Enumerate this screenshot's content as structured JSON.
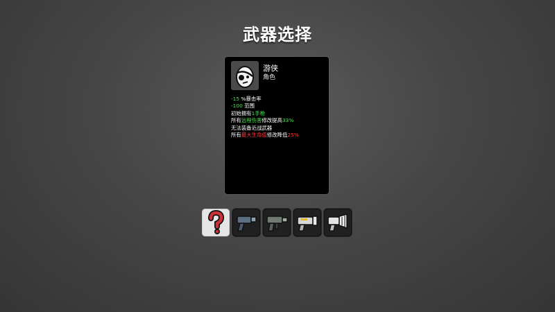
{
  "title": "武器选择",
  "character": {
    "name": "游侠",
    "type": "角色",
    "icon": "egg-eyepatch-icon"
  },
  "stats": [
    {
      "value": "-15",
      "value_color": "#47e64a",
      "text": " %暴击率"
    },
    {
      "value": "-100",
      "value_color": "#47e64a",
      "text": " 范围"
    },
    {
      "prefix": "初始拥有",
      "highlight": "1手枪",
      "highlight_color": "#47e64a"
    },
    {
      "prefix": "所有",
      "highlight": "远程伤害",
      "highlight_color": "#47e64a",
      "mid": "修改提高",
      "value": "33%",
      "value_color": "#47e64a"
    },
    {
      "prefix": "无法装备近战武器"
    },
    {
      "prefix": "所有",
      "highlight": "最大生命值",
      "highlight_color": "#ff3b3b",
      "mid": "修改降低",
      "value": "25%",
      "value_color": "#ff3b3b"
    }
  ],
  "weapons": [
    {
      "icon": "random-question-mark-icon",
      "selected": true
    },
    {
      "icon": "pistol-icon",
      "selected": false
    },
    {
      "icon": "smg-icon",
      "selected": false
    },
    {
      "icon": "shredder-gun-icon",
      "selected": false
    },
    {
      "icon": "minigun-icon",
      "selected": false
    }
  ]
}
